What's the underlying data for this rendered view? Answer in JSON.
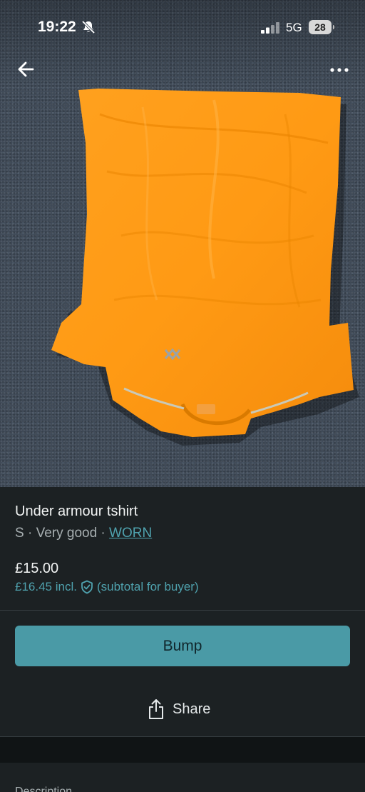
{
  "status_bar": {
    "time": "19:22",
    "network": "5G",
    "battery": "28",
    "icons": [
      "bell-slash-icon",
      "signal-icon",
      "battery-icon"
    ]
  },
  "nav": {
    "back_icon": "arrow-left-icon",
    "more_icon": "more-dots-icon"
  },
  "photo": {
    "subject": "orange t-shirt on grey carpet",
    "colors": {
      "shirt": "#ff9a1a",
      "carpet": "#3f4a57"
    }
  },
  "item": {
    "title": "Under armour tshirt",
    "size": "S",
    "separator": " · ",
    "condition": "Very good",
    "brand_link": "WORN",
    "price": "£15.00",
    "buyer_price": "£16.45 incl.",
    "buyer_note": "(subtotal for buyer)"
  },
  "actions": {
    "bump_label": "Bump",
    "share_label": "Share"
  },
  "description": {
    "label": "Description"
  },
  "colors": {
    "accent": "#4a9aa6",
    "link": "#4fa2ae",
    "background": "#1c2123"
  }
}
